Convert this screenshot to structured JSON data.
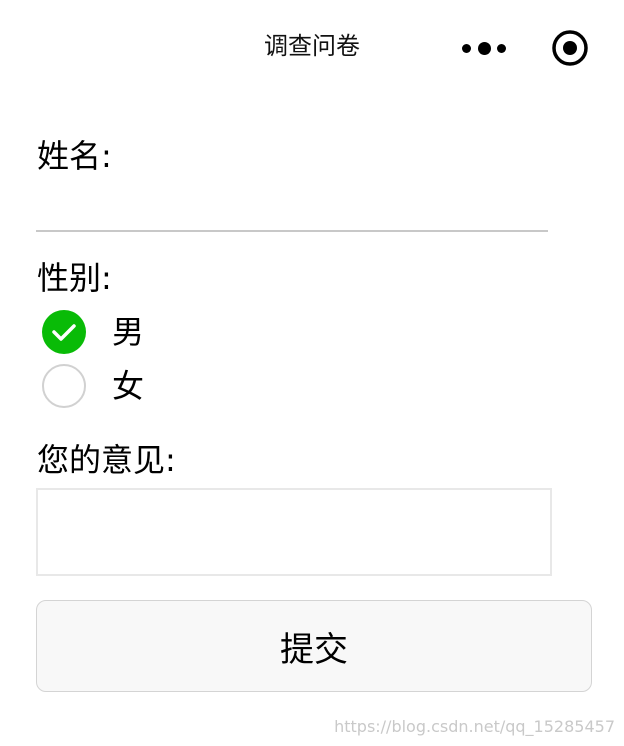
{
  "nav": {
    "title": "调查问卷",
    "more_icon": "more-dots-icon",
    "close_icon": "target-circle-icon"
  },
  "form": {
    "name_label": "姓名:",
    "name_value": "",
    "gender_label": "性别:",
    "gender_options": [
      {
        "label": "男",
        "checked": true
      },
      {
        "label": "女",
        "checked": false
      }
    ],
    "opinion_label": "您的意见:",
    "opinion_value": "",
    "submit_label": "提交"
  },
  "watermark": "https://blog.csdn.net/qq_15285457",
  "colors": {
    "radio_checked": "#09bb07",
    "radio_border": "#d1d1d1",
    "button_bg": "#f8f8f8"
  }
}
